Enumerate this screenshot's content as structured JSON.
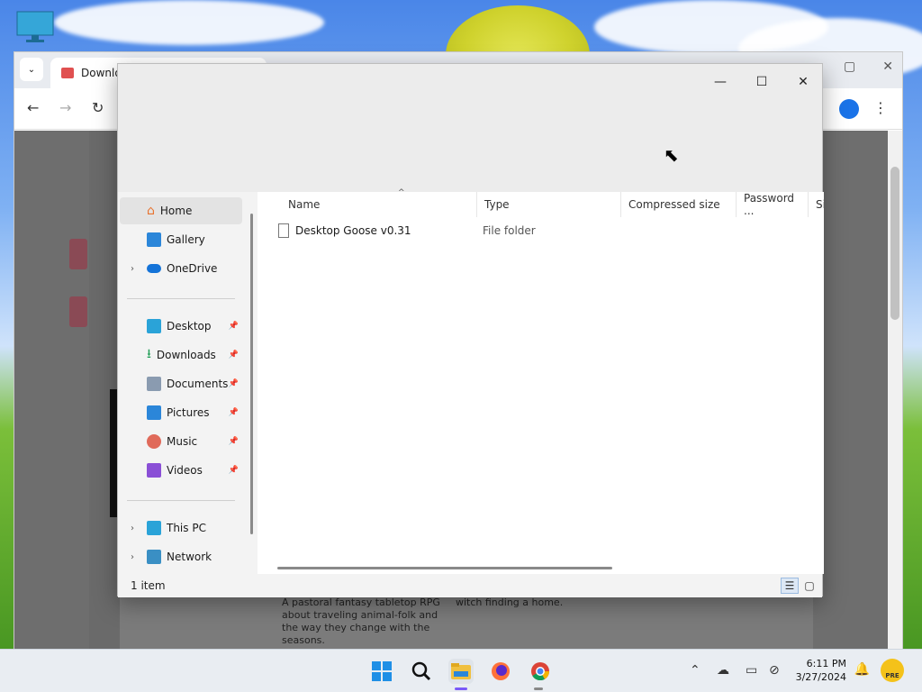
{
  "browser": {
    "tab_title": "Downloa",
    "page_bottom_desc": "A pastoral fantasy tabletop RPG about traveling animal-folk and the way they change with the seasons.",
    "page_bottom_desc2": "witch finding a home."
  },
  "explorer": {
    "controls": {
      "minimize": "—",
      "maximize": "☐",
      "close": "✕"
    },
    "nav": {
      "home": "Home",
      "gallery": "Gallery",
      "onedrive": "OneDrive",
      "desktop": "Desktop",
      "downloads": "Downloads",
      "documents": "Documents",
      "pictures": "Pictures",
      "music": "Music",
      "videos": "Videos",
      "thispc": "This PC",
      "network": "Network"
    },
    "columns": {
      "name": "Name",
      "type": "Type",
      "compressed_size": "Compressed size",
      "password": "Password ...",
      "size": "Si"
    },
    "rows": [
      {
        "name": "Desktop Goose v0.31",
        "type": "File folder"
      }
    ],
    "status": "1 item"
  },
  "taskbar": {
    "time": "6:11 PM",
    "date": "3/27/2024",
    "badge": "PRE"
  },
  "colors": {
    "accent": "#1a73e8",
    "taskbar_indicator": "#7a5af8",
    "folder": "#f0c040"
  }
}
